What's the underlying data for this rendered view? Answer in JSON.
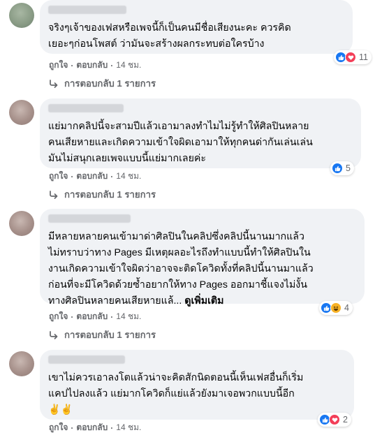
{
  "comments": [
    {
      "text": "จริงๆเจ้าของเฟสหรือเพจนี้ก็เป็นคนมีชื่อเสียงนะคะ ควรคิด\nเยอะๆก่อนโพสต์ ว่ามันจะสร้างผลกระทบต่อใครบ้าง",
      "reactions": [
        "like-icon",
        "love-icon"
      ],
      "reaction_count": "11",
      "like_label": "ถูกใจ",
      "reply_label": "ตอบกลับ",
      "time": "14 ชม.",
      "replies_label": "การตอบกลับ 1 รายการ"
    },
    {
      "text": "แย่มากคลิปนี้จะสามปีแล้วเอามาลงทำไมไม่รู้ทำให้ศิลปินหลาย\nคนเสียหายและเกิดความเข้าใจผิดเอามาให้ทุกคนด่ากันเล่นเล่น\nมันไม่สนุกเลยเพจแบบนี้แย่มากเลยค่ะ",
      "reactions": [
        "like-icon"
      ],
      "reaction_count": "5",
      "like_label": "ถูกใจ",
      "reply_label": "ตอบกลับ",
      "time": "14 ชม.",
      "replies_label": "การตอบกลับ 1 รายการ"
    },
    {
      "text": "มีหลายหลายคนเข้ามาด่าศิลปินในคลิปซึ่งคลิปนี้นานมากแล้ว\nไม่ทราบว่าทาง Pages มีเหตุผลอะไรถึงทำแบบนี้ทำให้ศิลปินใน\nงานเกิดความเข้าใจผิดว่าอาจจะติดโควิดทั้งที่คลิปนี้นานมาแล้ว\nก่อนที่จะมีโควิดด้วยซ้ำอยากให้ทาง Pages ออกมาชี้แจงไม่งั้น\nทางศิลปินหลายคนเสียหายแล้...",
      "see_more": "ดูเพิ่มเติม",
      "reactions": [
        "like-icon",
        "haha-icon"
      ],
      "reaction_count": "4",
      "like_label": "ถูกใจ",
      "reply_label": "ตอบกลับ",
      "time": "14 ชม.",
      "replies_label": "การตอบกลับ 1 รายการ"
    },
    {
      "text": "เขาไม่ควรเอาลงโตแล้วน่าจะคิดสักนิดตอนนี้เห็นเฟสอื่นก็เริ่ม\nแคปไปลงแล้ว แย่มากโควิดก็แย่แล้วยังมาเจอพวกแบบนี้อีก\n✌️✌️",
      "reactions": [
        "like-icon",
        "love-icon"
      ],
      "reaction_count": "2",
      "like_label": "ถูกใจ",
      "reply_label": "ตอบกลับ",
      "time": "14 ชม."
    }
  ]
}
